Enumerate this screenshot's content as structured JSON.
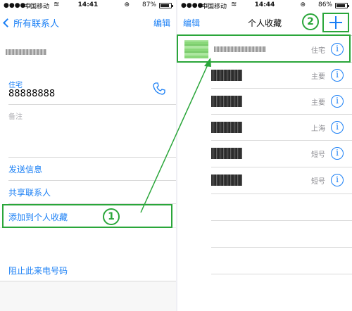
{
  "left": {
    "status": {
      "carrier": "中国移动",
      "wifi": "≋",
      "time": "14:41",
      "lock": "⊕",
      "battery": "87%",
      "battery_level": 0.87
    },
    "nav": {
      "back_label": "所有联系人",
      "edit_label": "编辑"
    },
    "phone": {
      "label": "住宅",
      "number": "88888888"
    },
    "note_label": "备注",
    "actions": {
      "send_message": "发送信息",
      "share_contact": "共享联系人",
      "add_favorite": "添加到个人收藏",
      "block_caller": "阻止此来电号码"
    }
  },
  "right": {
    "status": {
      "carrier": "中国移动",
      "wifi": "≋",
      "time": "14:44",
      "lock": "⊕",
      "battery": "86%",
      "battery_level": 0.86
    },
    "nav": {
      "edit_label": "编辑",
      "title": "个人收藏",
      "add_icon": "plus-icon"
    },
    "favorites": [
      {
        "type": "住宅"
      },
      {
        "type": "主要"
      },
      {
        "type": "主要"
      },
      {
        "type": "上海"
      },
      {
        "type": "短号"
      },
      {
        "type": "短号"
      }
    ]
  },
  "annotations": {
    "step1": "1",
    "step2": "2",
    "color": "#2aa63a"
  },
  "icons": {
    "phone": "phone-icon",
    "info": "info-icon",
    "back": "chevron-left-icon"
  },
  "colors": {
    "accent": "#1a7ff5",
    "annotation": "#2aa63a"
  }
}
